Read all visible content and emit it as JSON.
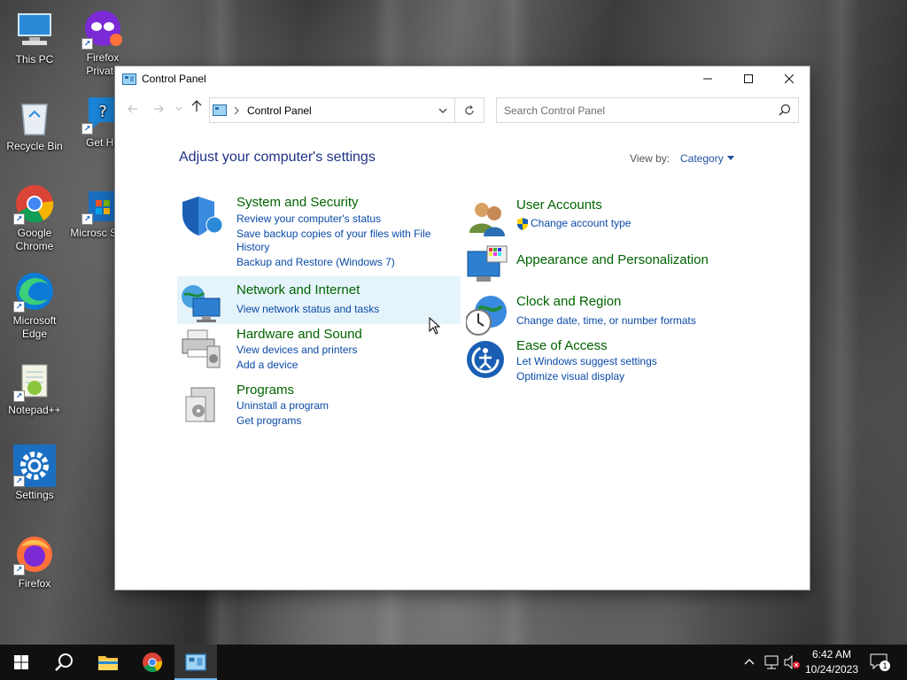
{
  "desktop": {
    "icons": [
      {
        "label": "This PC"
      },
      {
        "label": "Firefox Private"
      },
      {
        "label": "Recycle Bin"
      },
      {
        "label": "Get He"
      },
      {
        "label": "Google Chrome"
      },
      {
        "label": "Microsc Store"
      },
      {
        "label": "Microsoft Edge"
      },
      {
        "label": "Notepad++"
      },
      {
        "label": "Settings"
      },
      {
        "label": "Firefox"
      }
    ]
  },
  "window": {
    "title": "Control Panel",
    "address": "Control Panel",
    "search_placeholder": "Search Control Panel",
    "heading": "Adjust your computer's settings",
    "view_by_label": "View by:",
    "view_by_value": "Category",
    "categories_left": [
      {
        "title": "System and Security",
        "links": [
          "Review your computer's status",
          "Save backup copies of your files with File",
          "History",
          "Backup and Restore (Windows 7)"
        ]
      },
      {
        "title": "Network and Internet",
        "links": [
          "View network status and tasks"
        ]
      },
      {
        "title": "Hardware and Sound",
        "links": [
          "View devices and printers",
          "Add a device"
        ]
      },
      {
        "title": "Programs",
        "links": [
          "Uninstall a program",
          "Get programs"
        ]
      }
    ],
    "categories_right": [
      {
        "title": "User Accounts",
        "links": [
          "Change account type"
        ]
      },
      {
        "title": "Appearance and Personalization",
        "links": []
      },
      {
        "title": "Clock and Region",
        "links": [
          "Change date, time, or number formats"
        ]
      },
      {
        "title": "Ease of Access",
        "links": [
          "Let Windows suggest settings",
          "Optimize visual display"
        ]
      }
    ]
  },
  "taskbar": {
    "time": "6:42 AM",
    "date": "10/24/2023",
    "notification_count": "1"
  },
  "colors": {
    "category_title": "#006400",
    "link": "#0a4aa8",
    "heading": "#1e3287",
    "taskbar": "#101010"
  }
}
